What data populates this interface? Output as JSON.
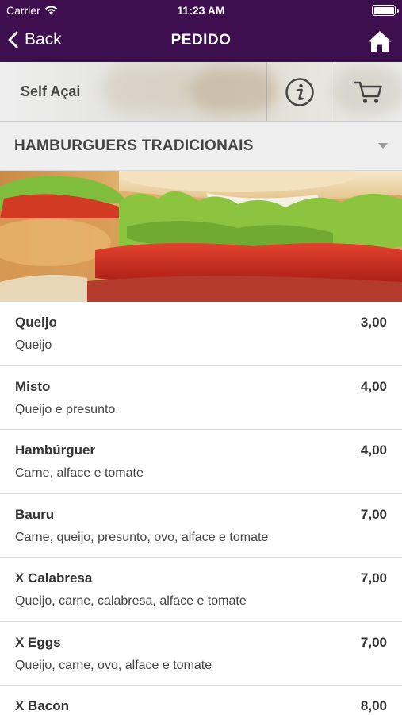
{
  "status": {
    "carrier": "Carrier",
    "time": "11:23 AM",
    "battery_level": 1.0
  },
  "nav": {
    "back_label": "Back",
    "title": "PEDIDO",
    "home_icon": "home-icon"
  },
  "store": {
    "name": "Self Açai",
    "info_icon": "info-icon",
    "cart_icon": "cart-icon"
  },
  "category": {
    "label": "HAMBURGUERS TRADICIONAIS",
    "icon": "dropdown-caret-icon"
  },
  "colors": {
    "primary": "#3d0f4f",
    "category_bg": "#efefef",
    "divider": "#dadada"
  },
  "items": [
    {
      "name": "Queijo",
      "price": "3,00",
      "description": "Queijo"
    },
    {
      "name": "Misto",
      "price": "4,00",
      "description": "Queijo e presunto."
    },
    {
      "name": "Hambúrguer",
      "price": "4,00",
      "description": "Carne, alface e tomate"
    },
    {
      "name": "Bauru",
      "price": "7,00",
      "description": "Carne, queijo, presunto, ovo, alface e tomate"
    },
    {
      "name": "X Calabresa",
      "price": "7,00",
      "description": "Queijo, carne, calabresa, alface e tomate"
    },
    {
      "name": "X Eggs",
      "price": "7,00",
      "description": "Queijo, carne, ovo, alface e tomate"
    },
    {
      "name": "X Bacon",
      "price": "8,00",
      "description": ""
    }
  ]
}
